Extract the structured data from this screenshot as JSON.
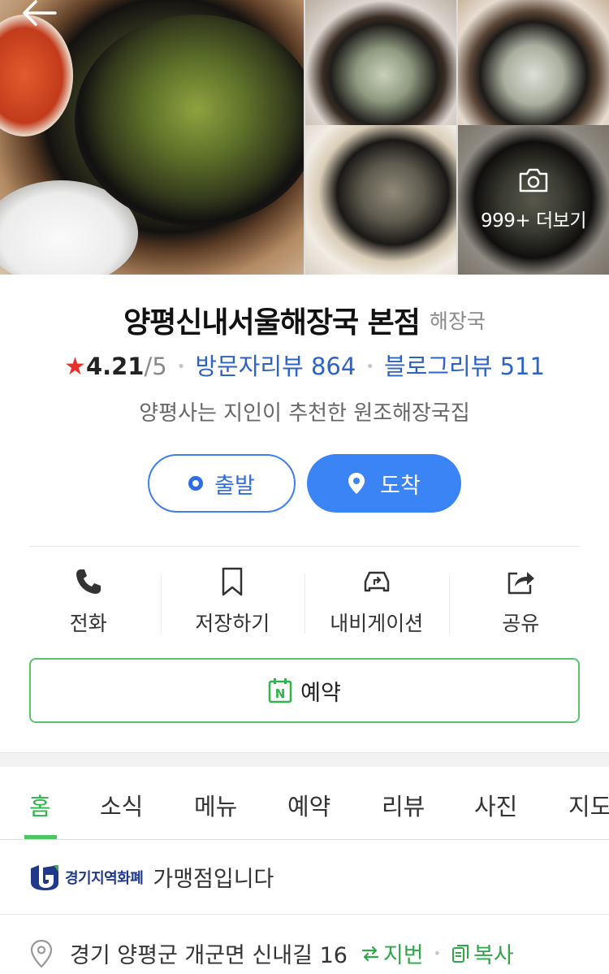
{
  "gallery": {
    "more_label": "999+ 더보기"
  },
  "place": {
    "name": "양평신내서울해장국 본점",
    "category": "해장국",
    "rating": "4.21",
    "rating_max": "/5",
    "visitor_reviews": "방문자리뷰 864",
    "blog_reviews": "블로그리뷰 511",
    "description": "양평사는 지인이 추천한 원조해장국집"
  },
  "directions": {
    "depart_label": "출발",
    "arrive_label": "도착"
  },
  "actions": {
    "call_label": "전화",
    "save_label": "저장하기",
    "navigation_label": "내비게이션",
    "share_label": "공유"
  },
  "reserve": {
    "label": "예약",
    "icon_letter": "N"
  },
  "tabs": [
    {
      "label": "홈"
    },
    {
      "label": "소식"
    },
    {
      "label": "메뉴"
    },
    {
      "label": "예약"
    },
    {
      "label": "리뷰"
    },
    {
      "label": "사진"
    },
    {
      "label": "지도"
    }
  ],
  "info": {
    "currency_brand": "경기지역화폐",
    "currency_text": "가맹점입니다",
    "address": "경기 양평군 개군면 신내길 16",
    "lot_number_label": "지번",
    "copy_label": "복사"
  },
  "colors": {
    "accent_blue": "#3a84f5",
    "link_blue": "#2b64c6",
    "naver_green": "#2fb44b",
    "star_red": "#e5322d"
  }
}
